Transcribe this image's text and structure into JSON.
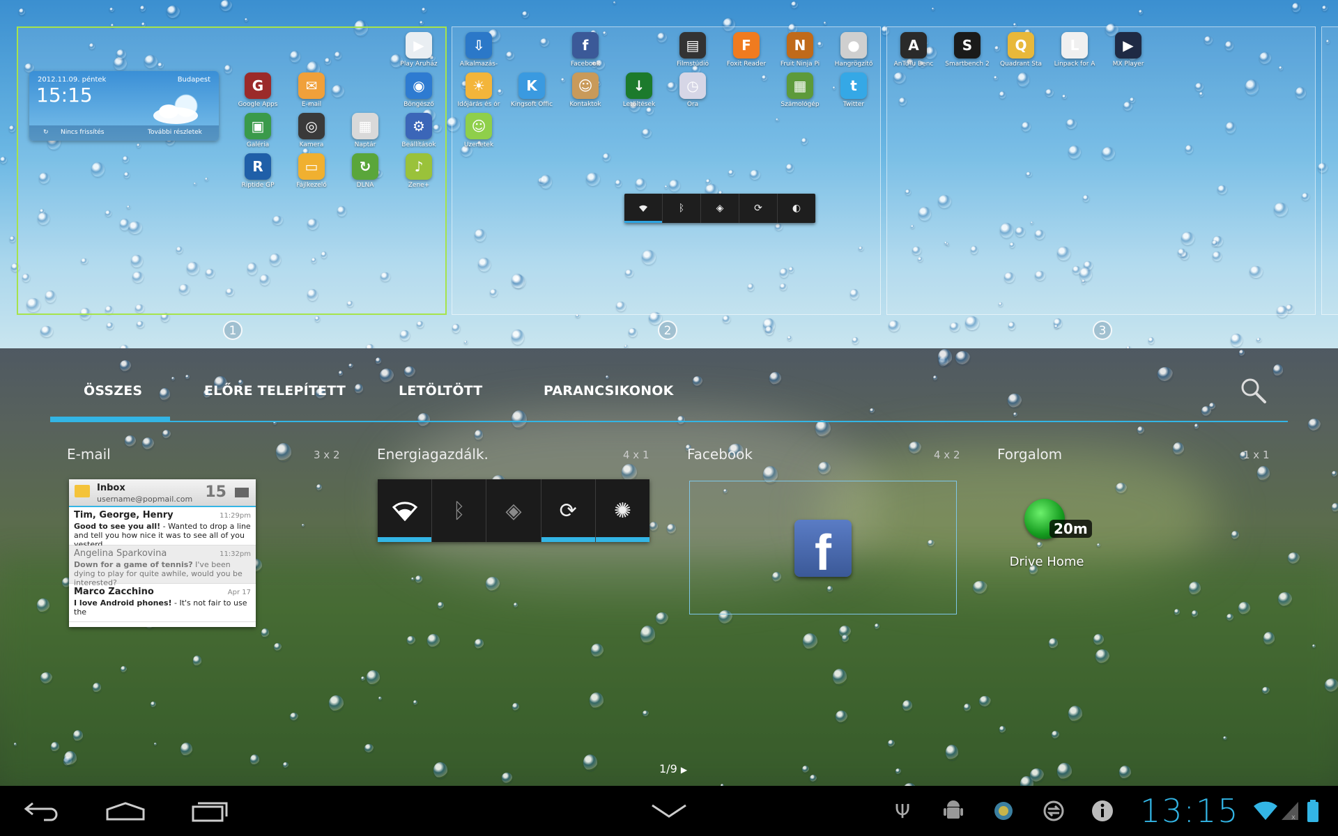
{
  "home_screens": {
    "pages": [
      "1",
      "2",
      "3"
    ],
    "screen1": {
      "widget": {
        "date": "2012.11.09. péntek",
        "city": "Budapest",
        "time": "15:15",
        "refresh": "Nincs frissítés",
        "details": "További részletek"
      },
      "apps": [
        {
          "label": "Play Áruház",
          "glyph": "▶",
          "color": "#e9eef2"
        },
        {
          "label": "Google Apps",
          "glyph": "G",
          "color": "#9b2a2a"
        },
        {
          "label": "E-mail",
          "glyph": "✉",
          "color": "#f0a03a"
        },
        {
          "label": "Böngésző",
          "glyph": "◉",
          "color": "#2e7bd1"
        },
        {
          "label": "Galéria",
          "glyph": "▣",
          "color": "#3a9a4a"
        },
        {
          "label": "Kamera",
          "glyph": "◎",
          "color": "#3a3a3a"
        },
        {
          "label": "Naptár",
          "glyph": "▦",
          "color": "#d9d9d9"
        },
        {
          "label": "Beállítások",
          "glyph": "⚙",
          "color": "#3b66b8"
        },
        {
          "label": "Riptide GP",
          "glyph": "R",
          "color": "#1f5fa8"
        },
        {
          "label": "Fájlkezelő",
          "glyph": "▭",
          "color": "#f0b030"
        },
        {
          "label": "DLNA",
          "glyph": "↻",
          "color": "#5aa63a"
        },
        {
          "label": "Zene+",
          "glyph": "♪",
          "color": "#9ac23a"
        }
      ]
    },
    "screen2": {
      "apps": [
        {
          "label": "Alkalmazás-",
          "glyph": "⇩",
          "color": "#2b78c8"
        },
        {
          "label": "Facebook",
          "glyph": "f",
          "color": "#3b5998"
        },
        {
          "label": "Filmstúdió",
          "glyph": "▤",
          "color": "#333333"
        },
        {
          "label": "Foxit Reader",
          "glyph": "F",
          "color": "#f07b1f"
        },
        {
          "label": "Fruit Ninja Pi",
          "glyph": "N",
          "color": "#c06a1a"
        },
        {
          "label": "Hangrögzítő",
          "glyph": "●",
          "color": "#cfcfcf"
        },
        {
          "label": "Időjárás és ór",
          "glyph": "☀",
          "color": "#f3b53a"
        },
        {
          "label": "Kingsoft Offic",
          "glyph": "K",
          "color": "#3a9ae0"
        },
        {
          "label": "Kontaktok",
          "glyph": "☺",
          "color": "#c99a5a"
        },
        {
          "label": "Letöltések",
          "glyph": "↓",
          "color": "#1c7a2c"
        },
        {
          "label": "Óra",
          "glyph": "◷",
          "color": "#d6d6e6"
        },
        {
          "label": "Számológép",
          "glyph": "▦",
          "color": "#5d9a3a"
        },
        {
          "label": "Twitter",
          "glyph": "t",
          "color": "#35a8e6"
        },
        {
          "label": "Üzenetek",
          "glyph": "☺",
          "color": "#8fcf4a"
        }
      ]
    },
    "screen3": {
      "apps": [
        {
          "label": "AnTuTu Benc",
          "glyph": "A",
          "color": "#2a2a2a"
        },
        {
          "label": "Smartbench 2",
          "glyph": "S",
          "color": "#1a1a1a"
        },
        {
          "label": "Quadrant Sta",
          "glyph": "Q",
          "color": "#e8b83a"
        },
        {
          "label": "Linpack for A",
          "glyph": "L",
          "color": "#f0f0f0"
        },
        {
          "label": "MX Player",
          "glyph": "▶",
          "color": "#1f2a44"
        }
      ]
    }
  },
  "drawer": {
    "tabs": [
      "ÖSSZES",
      "ELŐRE TELEPÍTETT",
      "LETÖLTÖTT",
      "PARANCSIKONOK"
    ],
    "active_tab": "ÖSSZES",
    "widgets": [
      {
        "title": "E-mail",
        "size": "3 x 2"
      },
      {
        "title": "Energiagazdálk.",
        "size": "4 x 1"
      },
      {
        "title": "Facebook",
        "size": "4 x 2"
      },
      {
        "title": "Forgalom",
        "size": "1 x 1"
      }
    ],
    "email": {
      "folder": "Inbox",
      "account": "username@popmail.com",
      "count": "15",
      "messages": [
        {
          "from": "Tim, George, Henry",
          "time": "11:29pm",
          "subject": "Good to see you all!",
          "snippet": " - Wanted to drop a line and tell you how nice it was to see all of you yesterd..."
        },
        {
          "from": "Angelina Sparkovina",
          "time": "11:32pm",
          "subject": "Down for a game of tennis?",
          "snippet": " I've been dying to play for quite awhile, would you be interested?"
        },
        {
          "from": "Marco Zacchino",
          "time": "Apr 17",
          "subject": "I love Android phones!",
          "snippet": " - It's not fair to use the"
        }
      ]
    },
    "traffic": {
      "minutes": "20m",
      "label": "Drive Home"
    },
    "pager": "1/9"
  },
  "status": {
    "time": "13:15"
  },
  "colors": {
    "accent": "#33b5e5",
    "active_screen_border": "#a6e34b"
  }
}
